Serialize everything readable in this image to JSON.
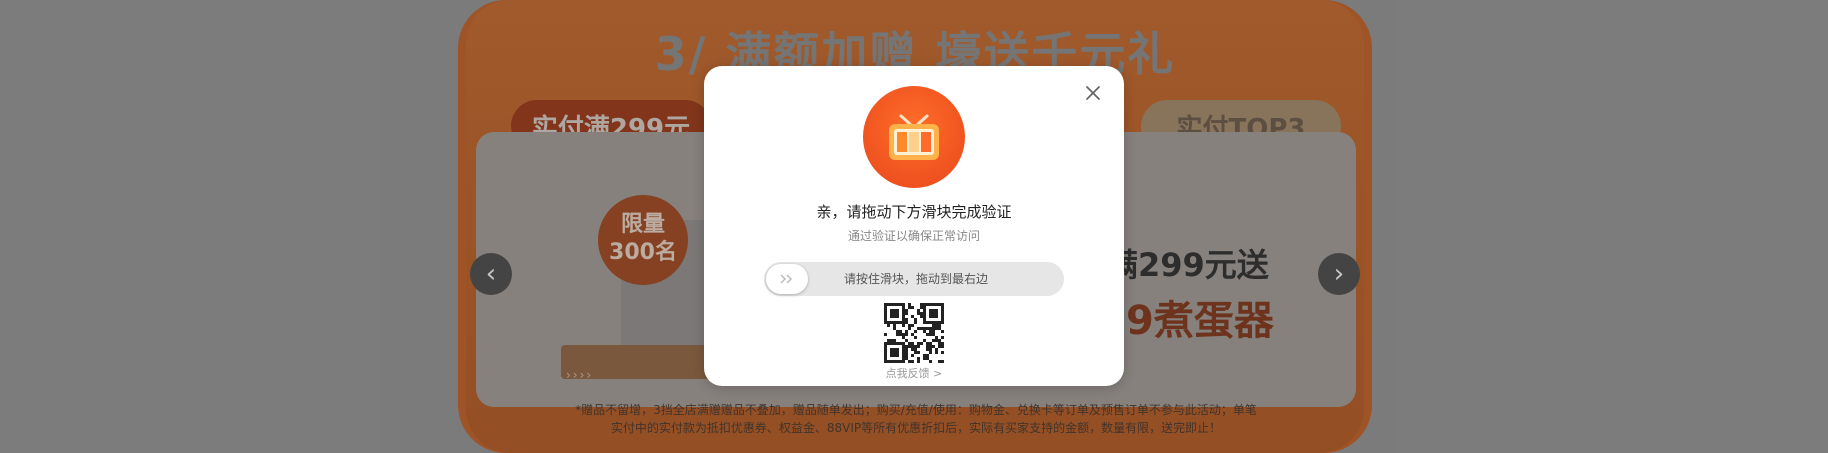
{
  "banner": {
    "title": "3/ 满额加赠 壕送千元礼",
    "tab_left": "实付满299元",
    "tab_right": "实付TOP3",
    "badge_line1": "限量",
    "badge_line2": "300名",
    "promo_line1": "满299元送",
    "promo_line2": "9煮蛋器",
    "stand_arrows": "››››",
    "footnote_line1": "*赠品不留增，3挡全店满赠赠品不叠加，赠品随单发出；购买/充值/使用：购物金、兑换卡等订单及预售订单不参与此活动；单笔",
    "footnote_line2": "实付中的实付款为抵扣优惠券、权益金、88VIP等所有优惠折扣后，实际有买家支持的金额，数量有限，送完即止！"
  },
  "nav": {
    "prev": "‹",
    "next": "›"
  },
  "modal": {
    "title": "亲，请拖动下方滑块完成验证",
    "subtitle": "通过验证以确保正常访问",
    "slider_hint": "请按住滑块，拖动到最右边",
    "feedback": "点我反馈 >"
  },
  "colors": {
    "accent": "#ff5a1f",
    "modal_bg": "#ffffff"
  },
  "icons": {
    "logo": "tv-icon",
    "close": "close-icon",
    "slider": "double-chevron-right-icon",
    "qr": "qr-code-icon"
  }
}
